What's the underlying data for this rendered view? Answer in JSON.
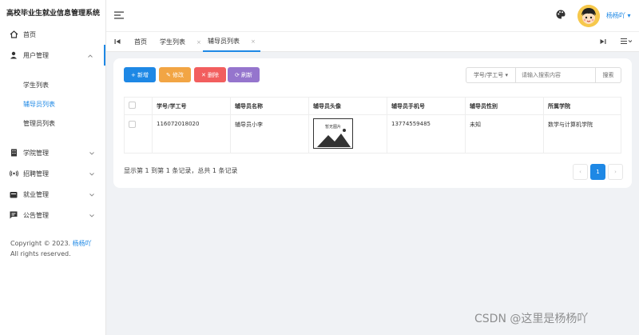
{
  "app": {
    "title": "高校毕业生就业信息管理系统"
  },
  "sidebar": {
    "items": [
      {
        "label": "首页",
        "icon": "home-icon"
      },
      {
        "label": "用户管理",
        "icon": "user-icon",
        "expanded": true,
        "children": [
          "学生列表",
          "辅导员列表",
          "管理员列表"
        ],
        "active_child": "辅导员列表"
      },
      {
        "label": "学院管理",
        "icon": "building-icon"
      },
      {
        "label": "招聘管理",
        "icon": "broadcast-icon"
      },
      {
        "label": "就业管理",
        "icon": "briefcase-icon"
      },
      {
        "label": "公告管理",
        "icon": "message-icon"
      }
    ],
    "copyright_prefix": "Copyright © 2023.",
    "copyright_author": "杨杨吖",
    "copyright_suffix": "All rights reserved."
  },
  "header": {
    "username": "杨杨吖",
    "username_caret": "▾"
  },
  "tabs": {
    "items": [
      {
        "label": "首页",
        "closable": false
      },
      {
        "label": "学生列表",
        "closable": true
      },
      {
        "label": "辅导员列表",
        "closable": true,
        "active": true
      }
    ],
    "close_glyph": "×"
  },
  "toolbar": {
    "add": "+ 新增",
    "edit": "✎ 修改",
    "delete": "✕ 删除",
    "refresh": "⟳ 刷新",
    "search_field": "学号/学工号 ▾",
    "search_placeholder": "请输入搜索内容",
    "search_button": "搜索"
  },
  "table": {
    "columns": [
      "学号/学工号",
      "辅导员名称",
      "辅导员头像",
      "辅导员手机号",
      "辅导员性别",
      "所属学院"
    ],
    "rows": [
      {
        "id": "116072018020",
        "name": "辅导员小李",
        "avatar_text": "暂无图片",
        "phone": "13774559485",
        "gender": "未知",
        "college": "数学与计算机学院"
      }
    ]
  },
  "pagination": {
    "summary": "显示第 1 到第 1 条记录，总共 1 条记录",
    "prev": "‹",
    "current": "1",
    "next": "›"
  },
  "watermark": "CSDN @这里是杨杨吖",
  "colors": {
    "primary": "#1e88e5",
    "edit": "#f2a544",
    "delete": "#f25e5e",
    "refresh": "#9575cd"
  }
}
